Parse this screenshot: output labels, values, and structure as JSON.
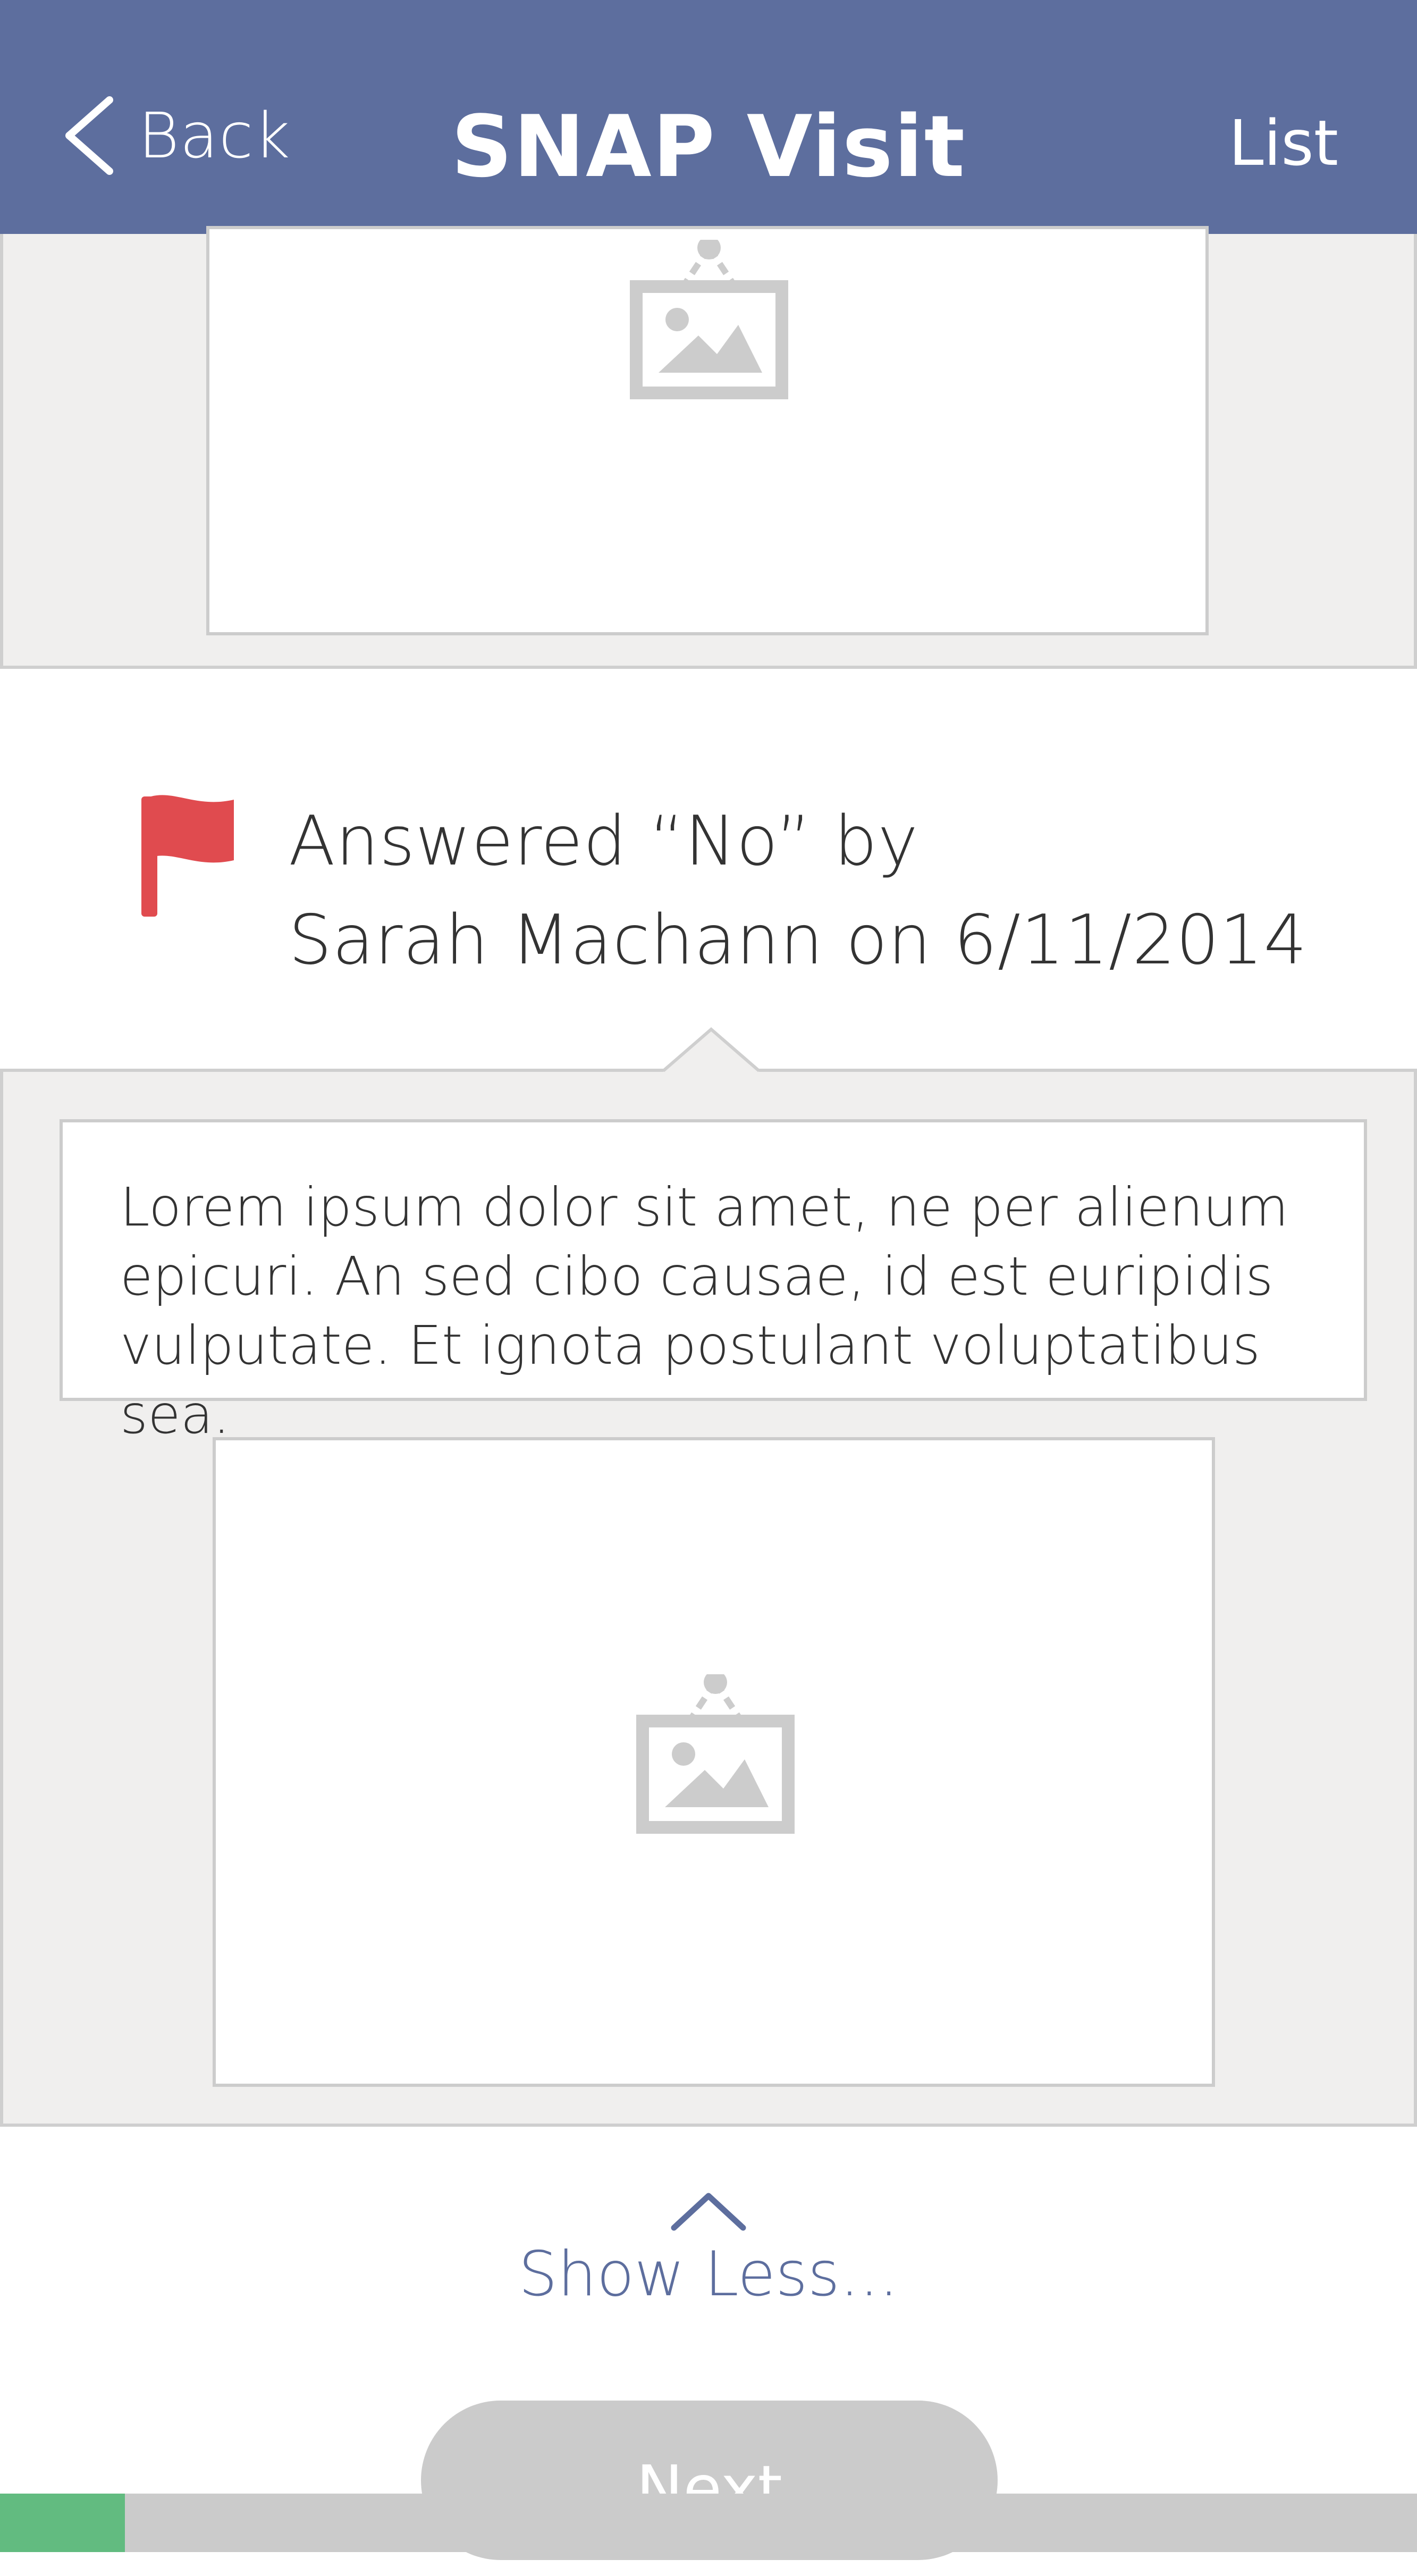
{
  "header": {
    "back_label": "Back",
    "title": "SNAP Visit",
    "list_label": "List",
    "background": "#5d6e9e"
  },
  "answer": {
    "line1": "Answered “No” by",
    "line2": "Sarah Machann on 6/11/2014",
    "flag_color": "#e04b4f"
  },
  "comment": {
    "text": "Lorem ipsum dolor sit amet, ne per alienum epicuri. An sed cibo causae, id est euripidis vulputate. Et ignota postulant voluptatibus sea."
  },
  "show_less": {
    "label": "Show Less...",
    "icon": "chevron-up-icon"
  },
  "next_button": {
    "label": "Next"
  },
  "progress": {
    "fraction": 0.088,
    "color": "#62bb80"
  },
  "icons": {
    "back": "chevron-left-icon",
    "image_placeholder": "image-placeholder-icon",
    "flag": "flag-icon"
  }
}
